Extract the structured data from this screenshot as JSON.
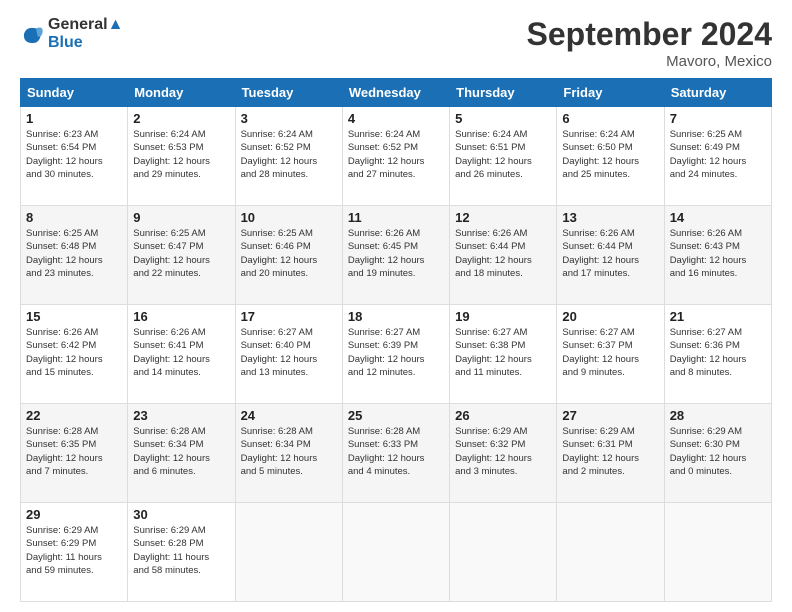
{
  "logo": {
    "line1": "General",
    "line2": "Blue"
  },
  "title": "September 2024",
  "location": "Mavoro, Mexico",
  "days_header": [
    "Sunday",
    "Monday",
    "Tuesday",
    "Wednesday",
    "Thursday",
    "Friday",
    "Saturday"
  ],
  "weeks": [
    [
      {
        "day": "1",
        "lines": [
          "Sunrise: 6:23 AM",
          "Sunset: 6:54 PM",
          "Daylight: 12 hours",
          "and 30 minutes."
        ]
      },
      {
        "day": "2",
        "lines": [
          "Sunrise: 6:24 AM",
          "Sunset: 6:53 PM",
          "Daylight: 12 hours",
          "and 29 minutes."
        ]
      },
      {
        "day": "3",
        "lines": [
          "Sunrise: 6:24 AM",
          "Sunset: 6:52 PM",
          "Daylight: 12 hours",
          "and 28 minutes."
        ]
      },
      {
        "day": "4",
        "lines": [
          "Sunrise: 6:24 AM",
          "Sunset: 6:52 PM",
          "Daylight: 12 hours",
          "and 27 minutes."
        ]
      },
      {
        "day": "5",
        "lines": [
          "Sunrise: 6:24 AM",
          "Sunset: 6:51 PM",
          "Daylight: 12 hours",
          "and 26 minutes."
        ]
      },
      {
        "day": "6",
        "lines": [
          "Sunrise: 6:24 AM",
          "Sunset: 6:50 PM",
          "Daylight: 12 hours",
          "and 25 minutes."
        ]
      },
      {
        "day": "7",
        "lines": [
          "Sunrise: 6:25 AM",
          "Sunset: 6:49 PM",
          "Daylight: 12 hours",
          "and 24 minutes."
        ]
      }
    ],
    [
      {
        "day": "8",
        "lines": [
          "Sunrise: 6:25 AM",
          "Sunset: 6:48 PM",
          "Daylight: 12 hours",
          "and 23 minutes."
        ]
      },
      {
        "day": "9",
        "lines": [
          "Sunrise: 6:25 AM",
          "Sunset: 6:47 PM",
          "Daylight: 12 hours",
          "and 22 minutes."
        ]
      },
      {
        "day": "10",
        "lines": [
          "Sunrise: 6:25 AM",
          "Sunset: 6:46 PM",
          "Daylight: 12 hours",
          "and 20 minutes."
        ]
      },
      {
        "day": "11",
        "lines": [
          "Sunrise: 6:26 AM",
          "Sunset: 6:45 PM",
          "Daylight: 12 hours",
          "and 19 minutes."
        ]
      },
      {
        "day": "12",
        "lines": [
          "Sunrise: 6:26 AM",
          "Sunset: 6:44 PM",
          "Daylight: 12 hours",
          "and 18 minutes."
        ]
      },
      {
        "day": "13",
        "lines": [
          "Sunrise: 6:26 AM",
          "Sunset: 6:44 PM",
          "Daylight: 12 hours",
          "and 17 minutes."
        ]
      },
      {
        "day": "14",
        "lines": [
          "Sunrise: 6:26 AM",
          "Sunset: 6:43 PM",
          "Daylight: 12 hours",
          "and 16 minutes."
        ]
      }
    ],
    [
      {
        "day": "15",
        "lines": [
          "Sunrise: 6:26 AM",
          "Sunset: 6:42 PM",
          "Daylight: 12 hours",
          "and 15 minutes."
        ]
      },
      {
        "day": "16",
        "lines": [
          "Sunrise: 6:26 AM",
          "Sunset: 6:41 PM",
          "Daylight: 12 hours",
          "and 14 minutes."
        ]
      },
      {
        "day": "17",
        "lines": [
          "Sunrise: 6:27 AM",
          "Sunset: 6:40 PM",
          "Daylight: 12 hours",
          "and 13 minutes."
        ]
      },
      {
        "day": "18",
        "lines": [
          "Sunrise: 6:27 AM",
          "Sunset: 6:39 PM",
          "Daylight: 12 hours",
          "and 12 minutes."
        ]
      },
      {
        "day": "19",
        "lines": [
          "Sunrise: 6:27 AM",
          "Sunset: 6:38 PM",
          "Daylight: 12 hours",
          "and 11 minutes."
        ]
      },
      {
        "day": "20",
        "lines": [
          "Sunrise: 6:27 AM",
          "Sunset: 6:37 PM",
          "Daylight: 12 hours",
          "and 9 minutes."
        ]
      },
      {
        "day": "21",
        "lines": [
          "Sunrise: 6:27 AM",
          "Sunset: 6:36 PM",
          "Daylight: 12 hours",
          "and 8 minutes."
        ]
      }
    ],
    [
      {
        "day": "22",
        "lines": [
          "Sunrise: 6:28 AM",
          "Sunset: 6:35 PM",
          "Daylight: 12 hours",
          "and 7 minutes."
        ]
      },
      {
        "day": "23",
        "lines": [
          "Sunrise: 6:28 AM",
          "Sunset: 6:34 PM",
          "Daylight: 12 hours",
          "and 6 minutes."
        ]
      },
      {
        "day": "24",
        "lines": [
          "Sunrise: 6:28 AM",
          "Sunset: 6:34 PM",
          "Daylight: 12 hours",
          "and 5 minutes."
        ]
      },
      {
        "day": "25",
        "lines": [
          "Sunrise: 6:28 AM",
          "Sunset: 6:33 PM",
          "Daylight: 12 hours",
          "and 4 minutes."
        ]
      },
      {
        "day": "26",
        "lines": [
          "Sunrise: 6:29 AM",
          "Sunset: 6:32 PM",
          "Daylight: 12 hours",
          "and 3 minutes."
        ]
      },
      {
        "day": "27",
        "lines": [
          "Sunrise: 6:29 AM",
          "Sunset: 6:31 PM",
          "Daylight: 12 hours",
          "and 2 minutes."
        ]
      },
      {
        "day": "28",
        "lines": [
          "Sunrise: 6:29 AM",
          "Sunset: 6:30 PM",
          "Daylight: 12 hours",
          "and 0 minutes."
        ]
      }
    ],
    [
      {
        "day": "29",
        "lines": [
          "Sunrise: 6:29 AM",
          "Sunset: 6:29 PM",
          "Daylight: 11 hours",
          "and 59 minutes."
        ]
      },
      {
        "day": "30",
        "lines": [
          "Sunrise: 6:29 AM",
          "Sunset: 6:28 PM",
          "Daylight: 11 hours",
          "and 58 minutes."
        ]
      },
      null,
      null,
      null,
      null,
      null
    ]
  ]
}
